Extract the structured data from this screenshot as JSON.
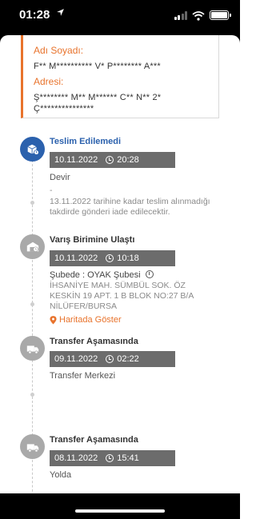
{
  "status_bar": {
    "time": "01:28",
    "location_icon": "location-arrow-icon",
    "icons": [
      "signal-icon",
      "wifi-icon",
      "battery-icon"
    ]
  },
  "address_card": {
    "name_label": "Adı Soyadı:",
    "name_value": "F** M********** V* P******** A***",
    "address_label": "Adresi:",
    "address_line1": "Ş******** M** M****** C** N** 2*",
    "address_line2": "Ç***************"
  },
  "events": [
    {
      "title": "Teslim Edilemedi",
      "date": "10.11.2022",
      "time": "20:28",
      "text": "Devir",
      "dash": "-",
      "note": "13.11.2022 tarihine kadar teslim alınmadığı takdirde gönderi iade edilecektir.",
      "icon": "package-warning-icon"
    },
    {
      "title": "Varış Birimine Ulaştı",
      "date": "10.11.2022",
      "time": "10:18",
      "text": "Şubede : OYAK Şubesi",
      "address": "İHSANİYE MAH. SÜMBÜL SOK. ÖZ KESKİN 19 APT. 1 B BLOK NO:27 B/A NİLÜFER/BURSA",
      "map_link": "Haritada Göster",
      "icon": "warehouse-icon"
    },
    {
      "title": "Transfer Aşamasında",
      "date": "09.11.2022",
      "time": "02:22",
      "text": "Transfer Merkezi",
      "icon": "truck-icon"
    },
    {
      "title": "Transfer Aşamasında",
      "date": "08.11.2022",
      "time": "15:41",
      "text": "Yolda",
      "icon": "truck-icon"
    }
  ],
  "colors": {
    "accent": "#e8732c",
    "active": "#2b61ad",
    "pill": "#6c6c6c",
    "inactive_icon": "#a9a9a9"
  }
}
